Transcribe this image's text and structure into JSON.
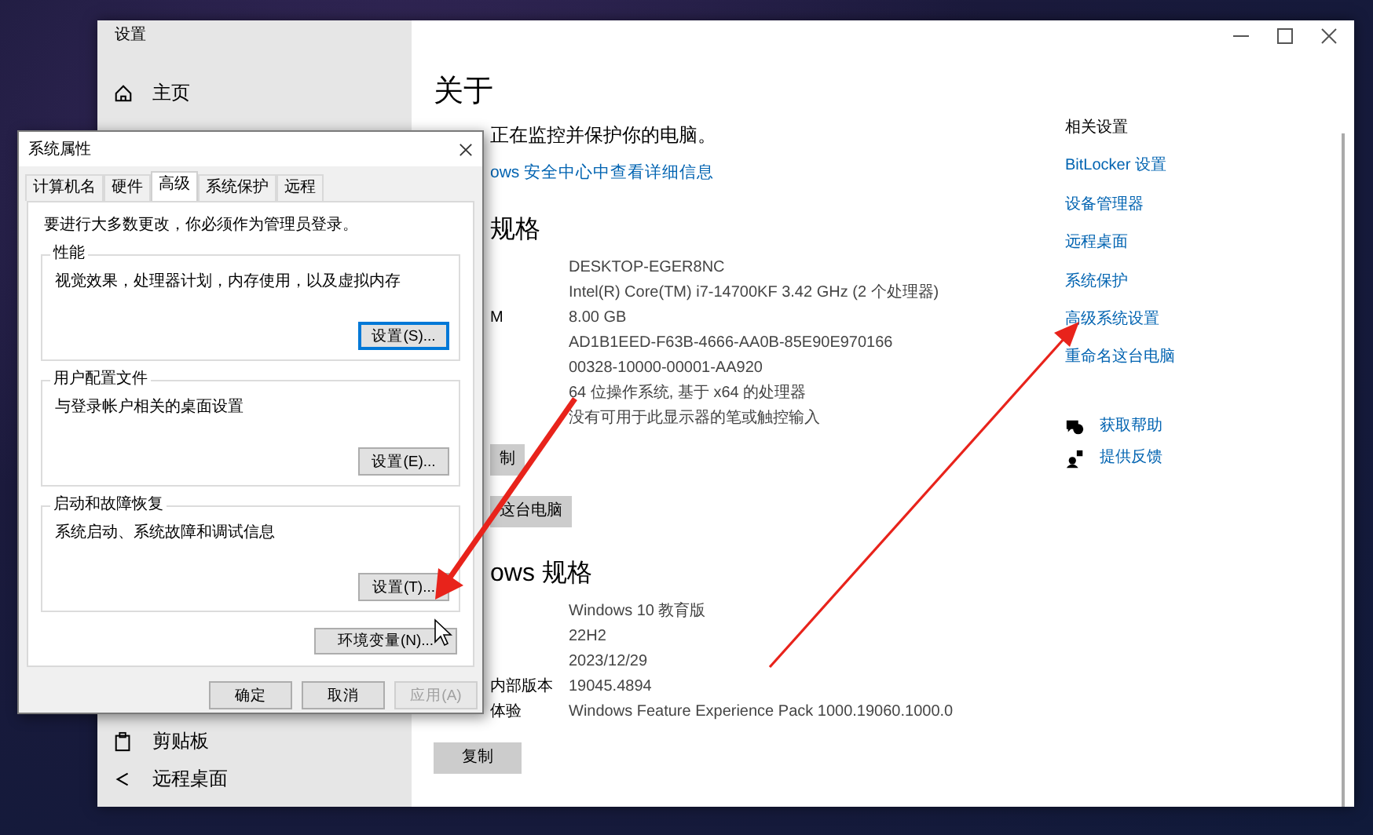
{
  "settings_window": {
    "title": "设置",
    "nav_top": [
      {
        "kind": "home",
        "label": "主页"
      }
    ],
    "nav_bottom": [
      {
        "kind": "clipboard",
        "label": "剪贴板"
      },
      {
        "kind": "remote",
        "label": "远程桌面"
      }
    ],
    "heading": "关于",
    "security_text": "正在监控并保护你的电脑。",
    "security_link": "ows 安全中心中查看详细信息",
    "device_specs": {
      "heading": "规格",
      "rows": [
        {
          "value": "DESKTOP-EGER8NC"
        },
        {
          "value": "Intel(R) Core(TM) i7-14700KF   3.42 GHz  (2 个处理器)"
        },
        {
          "label": "M",
          "value": "8.00 GB"
        },
        {
          "value": "AD1B1EED-F63B-4666-AA0B-85E90E970166"
        },
        {
          "value": "00328-10000-00001-AA920"
        },
        {
          "value": "64 位操作系统, 基于 x64 的处理器"
        },
        {
          "value": "没有可用于此显示器的笔或触控输入"
        }
      ],
      "buttons": [
        "制",
        "这台电脑"
      ]
    },
    "windows_specs": {
      "heading": "ows 规格",
      "rows": [
        {
          "value": "Windows 10 教育版"
        },
        {
          "value": "22H2"
        },
        {
          "value": "2023/12/29"
        },
        {
          "label": "内部版本",
          "value": "19045.4894"
        },
        {
          "label": "体验",
          "value": "Windows Feature Experience Pack 1000.19060.1000.0"
        }
      ],
      "button": "复制"
    },
    "related": {
      "heading": "相关设置",
      "links": [
        "BitLocker 设置",
        "设备管理器",
        "远程桌面",
        "系统保护",
        "高级系统设置",
        "重命名这台电脑"
      ]
    },
    "support": [
      {
        "kind": "help",
        "label": "获取帮助"
      },
      {
        "kind": "feedback",
        "label": "提供反馈"
      }
    ]
  },
  "dialog": {
    "title": "系统属性",
    "tabs": [
      {
        "label": "计算机名",
        "selected": false
      },
      {
        "label": "硬件",
        "selected": false
      },
      {
        "label": "高级",
        "selected": true
      },
      {
        "label": "系统保护",
        "selected": false
      },
      {
        "label": "远程",
        "selected": false
      }
    ],
    "notice": "要进行大多数更改，你必须作为管理员登录。",
    "groups": [
      {
        "title": "性能",
        "description": "视觉效果，处理器计划，内存使用，以及虚拟内存",
        "button": "设置(S)...",
        "focused": true
      },
      {
        "title": "用户配置文件",
        "description": "与登录帐户相关的桌面设置",
        "button": "设置(E)...",
        "focused": false
      },
      {
        "title": "启动和故障恢复",
        "description": "系统启动、系统故障和调试信息",
        "button": "设置(T)...",
        "focused": false
      }
    ],
    "env_button": "环境变量(N)...",
    "buttons": [
      {
        "label": "确定",
        "disabled": false
      },
      {
        "label": "取消",
        "disabled": false
      },
      {
        "label": "应用(A)",
        "disabled": true
      }
    ]
  }
}
